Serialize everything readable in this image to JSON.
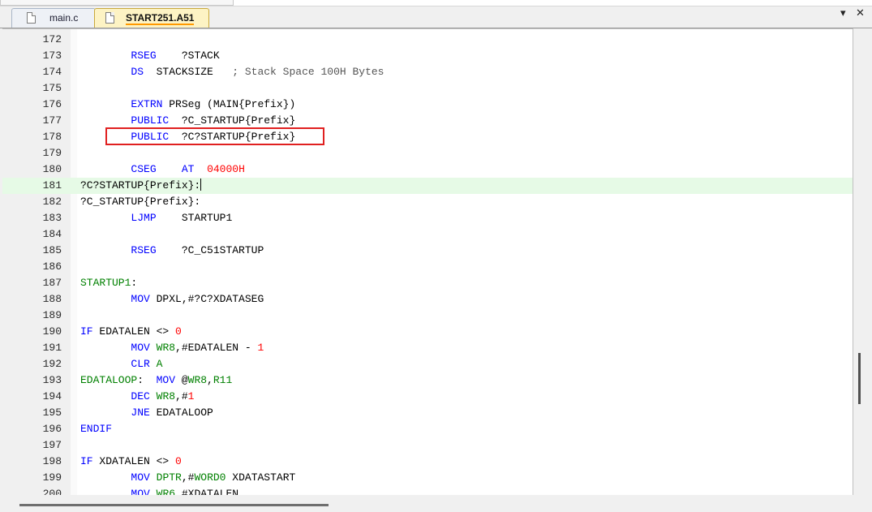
{
  "tabs": [
    {
      "label": "main.c",
      "active": false
    },
    {
      "label": "START251.A51",
      "active": true
    }
  ],
  "tab_controls": {
    "dropdown": "▾",
    "close": "✕"
  },
  "colors": {
    "keyword": "#0000ff",
    "number": "#ff0000",
    "label": "#008000",
    "active_line": "#e6fae6",
    "highlight_box": "#e02020"
  },
  "editor": {
    "active_line": "181",
    "highlighted_line": "180",
    "lines": [
      {
        "num": "172",
        "parts": []
      },
      {
        "num": "173",
        "parts": [
          {
            "t": "        "
          },
          {
            "t": "RSEG",
            "c": "kw"
          },
          {
            "t": "    ?STACK"
          }
        ]
      },
      {
        "num": "174",
        "parts": [
          {
            "t": "        "
          },
          {
            "t": "DS",
            "c": "kw"
          },
          {
            "t": "  STACKSIZE   "
          },
          {
            "t": "; Stack Space 100H Bytes",
            "c": "cm"
          }
        ]
      },
      {
        "num": "175",
        "parts": []
      },
      {
        "num": "176",
        "parts": [
          {
            "t": "        "
          },
          {
            "t": "EXTRN",
            "c": "kw"
          },
          {
            "t": " PRSeg (MAIN{Prefix})"
          }
        ]
      },
      {
        "num": "177",
        "parts": [
          {
            "t": "        "
          },
          {
            "t": "PUBLIC",
            "c": "kw"
          },
          {
            "t": "  ?C_STARTUP{Prefix}"
          }
        ]
      },
      {
        "num": "178",
        "parts": [
          {
            "t": "        "
          },
          {
            "t": "PUBLIC",
            "c": "kw"
          },
          {
            "t": "  ?C?STARTUP{Prefix}"
          }
        ]
      },
      {
        "num": "179",
        "parts": []
      },
      {
        "num": "180",
        "parts": [
          {
            "t": "        "
          },
          {
            "t": "CSEG",
            "c": "kw"
          },
          {
            "t": "    "
          },
          {
            "t": "AT",
            "c": "kw"
          },
          {
            "t": "  "
          },
          {
            "t": "04000H",
            "c": "num"
          }
        ]
      },
      {
        "num": "181",
        "parts": [
          {
            "t": "?C?STARTUP{Prefix}:"
          }
        ],
        "caret": true
      },
      {
        "num": "182",
        "parts": [
          {
            "t": "?C_STARTUP{Prefix}:"
          }
        ]
      },
      {
        "num": "183",
        "parts": [
          {
            "t": "        "
          },
          {
            "t": "LJMP",
            "c": "kw"
          },
          {
            "t": "    STARTUP1"
          }
        ]
      },
      {
        "num": "184",
        "parts": []
      },
      {
        "num": "185",
        "parts": [
          {
            "t": "        "
          },
          {
            "t": "RSEG",
            "c": "kw"
          },
          {
            "t": "    ?C_C51STARTUP"
          }
        ]
      },
      {
        "num": "186",
        "parts": []
      },
      {
        "num": "187",
        "parts": [
          {
            "t": "STARTUP1",
            "c": "lbl"
          },
          {
            "t": ":"
          }
        ]
      },
      {
        "num": "188",
        "parts": [
          {
            "t": "        "
          },
          {
            "t": "MOV",
            "c": "kw"
          },
          {
            "t": " DPXL,#?C?XDATASEG"
          }
        ]
      },
      {
        "num": "189",
        "parts": []
      },
      {
        "num": "190",
        "parts": [
          {
            "t": "IF",
            "c": "kw"
          },
          {
            "t": " EDATALEN <> "
          },
          {
            "t": "0",
            "c": "num"
          }
        ]
      },
      {
        "num": "191",
        "parts": [
          {
            "t": "        "
          },
          {
            "t": "MOV",
            "c": "kw"
          },
          {
            "t": " "
          },
          {
            "t": "WR8",
            "c": "reg"
          },
          {
            "t": ",#EDATALEN - "
          },
          {
            "t": "1",
            "c": "num"
          }
        ]
      },
      {
        "num": "192",
        "parts": [
          {
            "t": "        "
          },
          {
            "t": "CLR",
            "c": "kw"
          },
          {
            "t": " "
          },
          {
            "t": "A",
            "c": "reg"
          }
        ]
      },
      {
        "num": "193",
        "parts": [
          {
            "t": "EDATALOOP",
            "c": "lbl"
          },
          {
            "t": ":  "
          },
          {
            "t": "MOV",
            "c": "kw"
          },
          {
            "t": " @"
          },
          {
            "t": "WR8",
            "c": "reg"
          },
          {
            "t": ","
          },
          {
            "t": "R11",
            "c": "reg"
          }
        ]
      },
      {
        "num": "194",
        "parts": [
          {
            "t": "        "
          },
          {
            "t": "DEC",
            "c": "kw"
          },
          {
            "t": " "
          },
          {
            "t": "WR8",
            "c": "reg"
          },
          {
            "t": ",#"
          },
          {
            "t": "1",
            "c": "num"
          }
        ]
      },
      {
        "num": "195",
        "parts": [
          {
            "t": "        "
          },
          {
            "t": "JNE",
            "c": "kw"
          },
          {
            "t": " EDATALOOP"
          }
        ]
      },
      {
        "num": "196",
        "parts": [
          {
            "t": "ENDIF",
            "c": "kw"
          }
        ]
      },
      {
        "num": "197",
        "parts": []
      },
      {
        "num": "198",
        "parts": [
          {
            "t": "IF",
            "c": "kw"
          },
          {
            "t": " XDATALEN <> "
          },
          {
            "t": "0",
            "c": "num"
          }
        ]
      },
      {
        "num": "199",
        "parts": [
          {
            "t": "        "
          },
          {
            "t": "MOV",
            "c": "kw"
          },
          {
            "t": " "
          },
          {
            "t": "DPTR",
            "c": "reg"
          },
          {
            "t": ",#"
          },
          {
            "t": "WORD0",
            "c": "reg"
          },
          {
            "t": " XDATASTART"
          }
        ]
      },
      {
        "num": "200",
        "parts": [
          {
            "t": "        "
          },
          {
            "t": "MOV",
            "c": "kw"
          },
          {
            "t": " "
          },
          {
            "t": "WR6",
            "c": "reg"
          },
          {
            "t": ",#XDATALEN"
          }
        ]
      }
    ]
  }
}
